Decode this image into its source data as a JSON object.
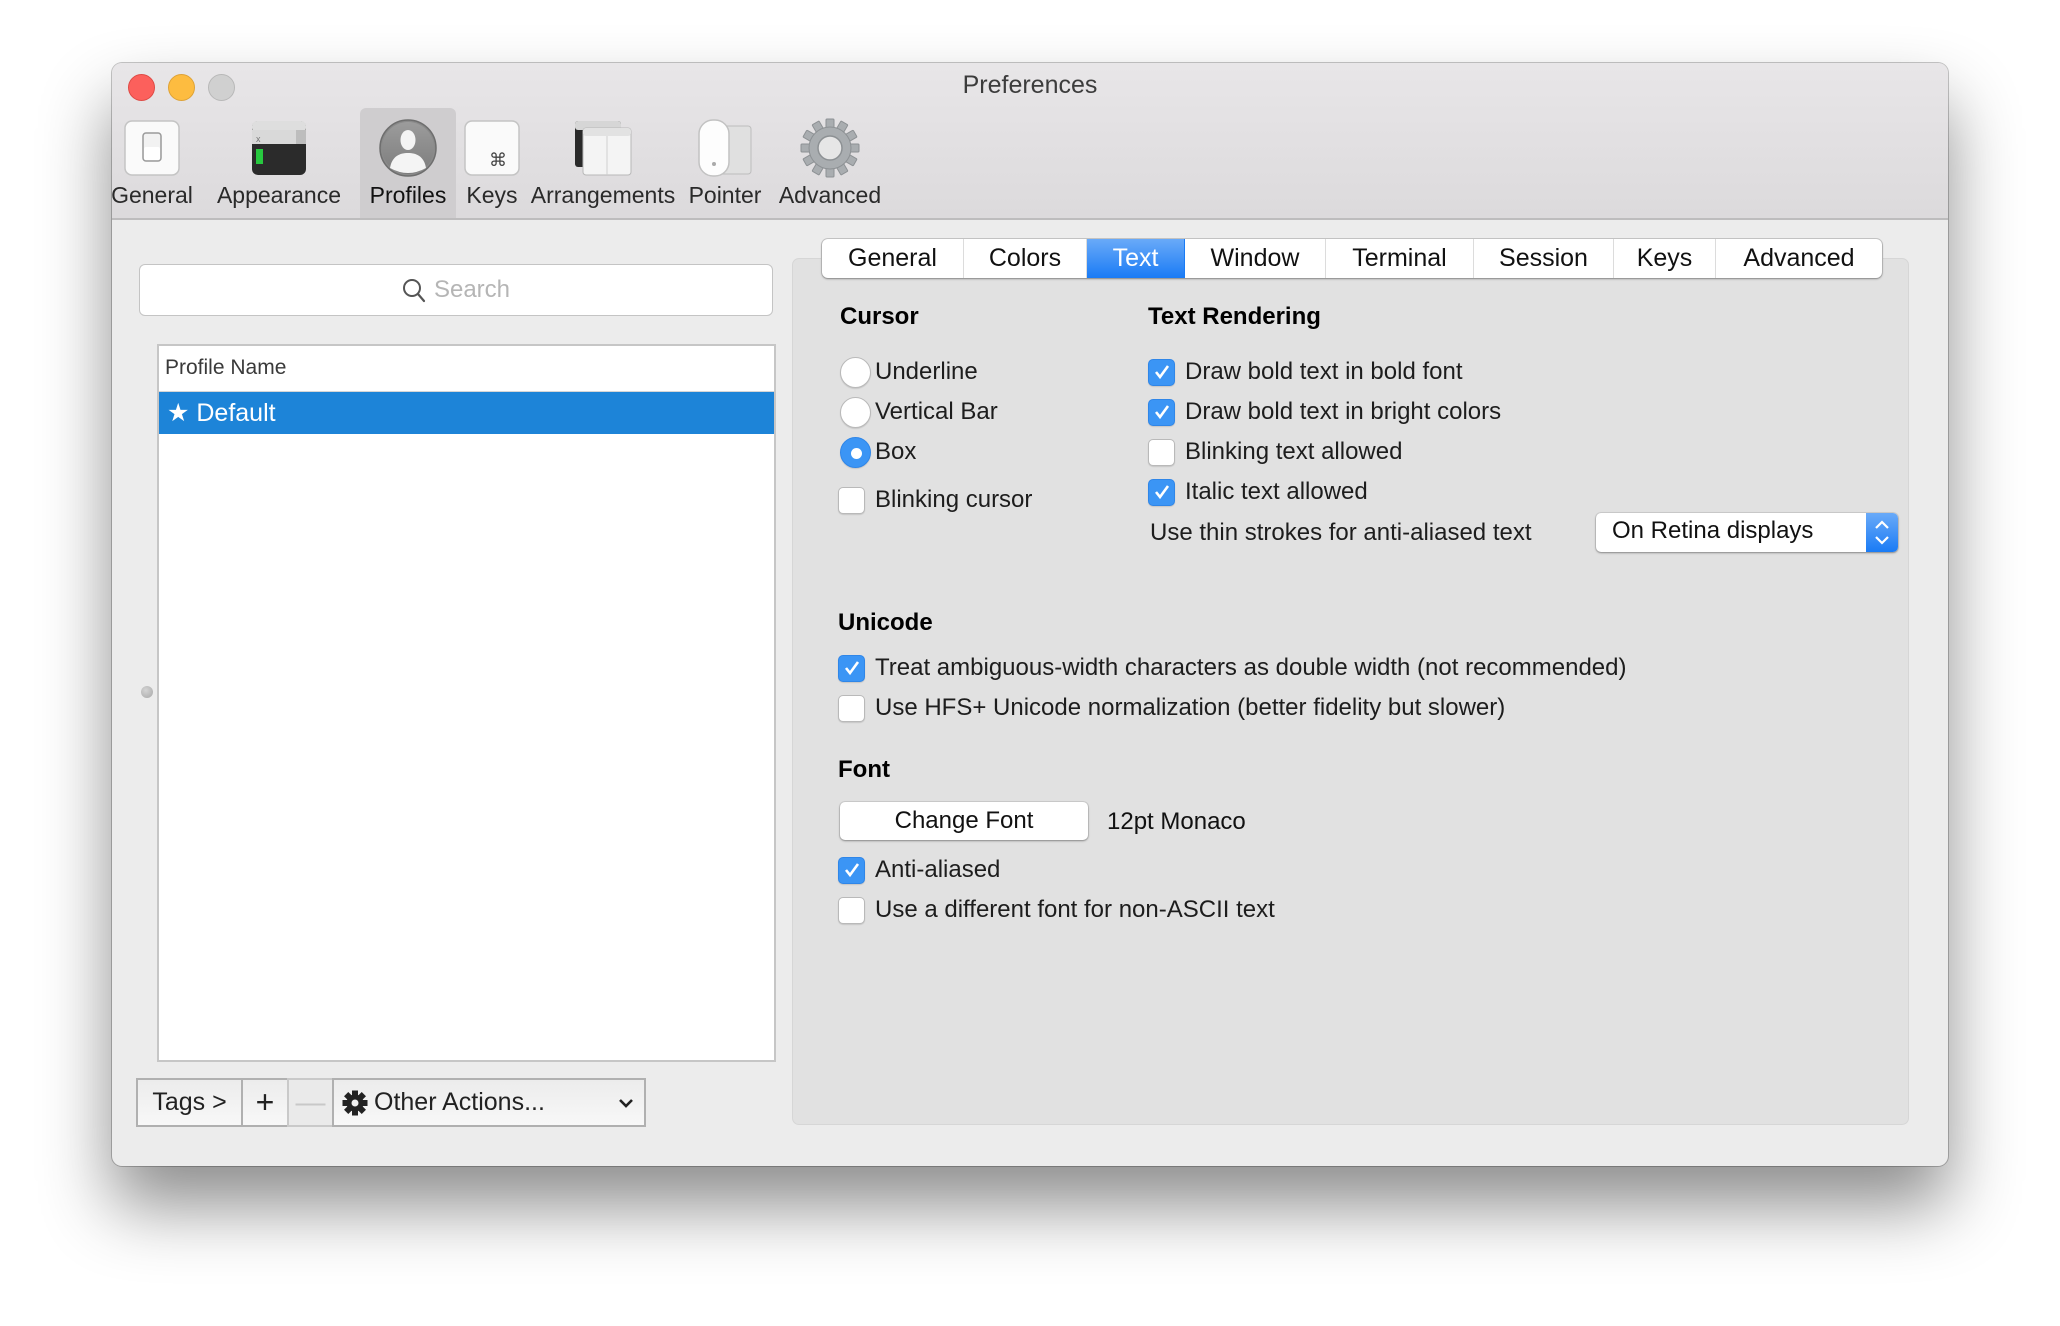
{
  "window": {
    "title": "Preferences"
  },
  "toolbar": {
    "items": [
      {
        "label": "General",
        "icon": "general-switch-icon",
        "selected": false
      },
      {
        "label": "Appearance",
        "icon": "appearance-terminal-icon",
        "selected": false
      },
      {
        "label": "Profiles",
        "icon": "profiles-user-icon",
        "selected": true
      },
      {
        "label": "Keys",
        "icon": "keys-command-icon",
        "selected": false
      },
      {
        "label": "Arrangements",
        "icon": "arrangements-windows-icon",
        "selected": false
      },
      {
        "label": "Pointer",
        "icon": "pointer-mouse-icon",
        "selected": false
      },
      {
        "label": "Advanced",
        "icon": "advanced-gear-icon",
        "selected": false
      }
    ]
  },
  "profiles": {
    "search_placeholder": "Search",
    "search_value": "",
    "column_header": "Profile Name",
    "rows": [
      {
        "name": "★ Default",
        "selected": true
      }
    ],
    "bottom_bar": {
      "tags_label": "Tags >",
      "add_label": "+",
      "remove_label": "—",
      "other_actions_label": "Other Actions..."
    }
  },
  "tabs": {
    "items": [
      "General",
      "Colors",
      "Text",
      "Window",
      "Terminal",
      "Session",
      "Keys",
      "Advanced"
    ],
    "active": "Text"
  },
  "text_tab": {
    "cursor": {
      "heading": "Cursor",
      "options": [
        {
          "label": "Underline",
          "selected": false
        },
        {
          "label": "Vertical Bar",
          "selected": false
        },
        {
          "label": "Box",
          "selected": true
        }
      ],
      "blinking_cursor": {
        "label": "Blinking cursor",
        "checked": false
      }
    },
    "text_rendering": {
      "heading": "Text Rendering",
      "options": [
        {
          "label": "Draw bold text in bold font",
          "checked": true
        },
        {
          "label": "Draw bold text in bright colors",
          "checked": true
        },
        {
          "label": "Blinking text allowed",
          "checked": false
        },
        {
          "label": "Italic text allowed",
          "checked": true
        }
      ],
      "thin_strokes_label": "Use thin strokes for anti-aliased text",
      "thin_strokes_value": "On Retina displays"
    },
    "unicode": {
      "heading": "Unicode",
      "options": [
        {
          "label": "Treat ambiguous-width characters as double width (not recommended)",
          "checked": true
        },
        {
          "label": "Use HFS+ Unicode normalization (better fidelity but slower)",
          "checked": false
        }
      ]
    },
    "font": {
      "heading": "Font",
      "change_font_label": "Change Font",
      "current_font": "12pt Monaco",
      "options": [
        {
          "label": "Anti-aliased",
          "checked": true
        },
        {
          "label": "Use a different font for non-ASCII text",
          "checked": false
        }
      ]
    }
  },
  "colors": {
    "accent": "#1a7bf5",
    "selection": "#1d84d8",
    "close": "#fc605c",
    "minimize": "#fdbc40",
    "zoom_disabled": "#d0d0d0"
  }
}
